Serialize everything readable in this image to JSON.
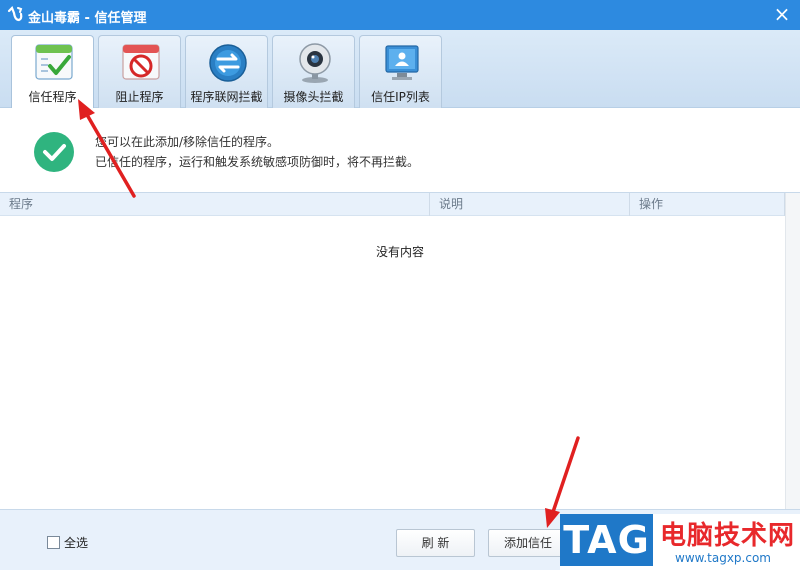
{
  "window": {
    "title": "金山毒霸 - 信任管理",
    "close_glyph": "×"
  },
  "tabs": [
    {
      "label": "信任程序",
      "icon": "trusted-program-icon",
      "active": true
    },
    {
      "label": "阻止程序",
      "icon": "block-program-icon",
      "active": false
    },
    {
      "label": "程序联网拦截",
      "icon": "network-block-icon",
      "active": false
    },
    {
      "label": "摄像头拦截",
      "icon": "webcam-icon",
      "active": false
    },
    {
      "label": "信任IP列表",
      "icon": "trusted-ip-icon",
      "active": false
    }
  ],
  "info": {
    "line1": "您可以在此添加/移除信任的程序。",
    "line2": "已信任的程序，运行和触发系统敏感项防御时，将不再拦截。"
  },
  "table": {
    "columns": [
      "程序",
      "说明",
      "操作"
    ],
    "rows": [],
    "empty_text": "没有内容"
  },
  "footer": {
    "select_all_label": "全选",
    "select_all_checked": false,
    "refresh_label": "刷 新",
    "add_trust_label": "添加信任"
  },
  "watermark": {
    "badge": "TAG",
    "title": "电脑技术网",
    "url": "www.tagxp.com"
  },
  "colors": {
    "titlebar": "#2d8ae0",
    "accent_green": "#2fb47f",
    "annotation_red": "#e02020",
    "header_bg": "#e8f1fb"
  }
}
